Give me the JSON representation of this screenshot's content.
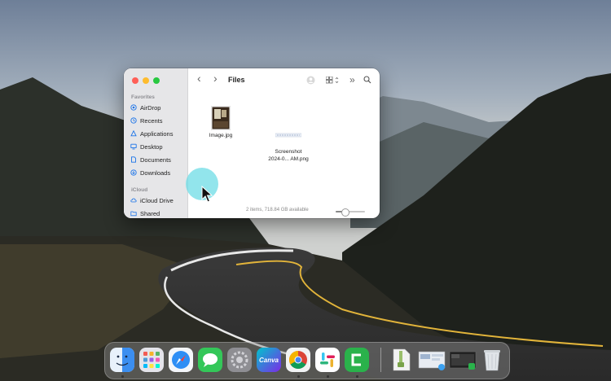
{
  "window": {
    "title": "Files",
    "nav": {
      "back": "‹",
      "forward": "›",
      "more": "»"
    },
    "sidebar": {
      "favorites_label": "Favorites",
      "favorites": [
        {
          "label": "AirDrop",
          "icon": "airdrop-icon"
        },
        {
          "label": "Recents",
          "icon": "clock-icon"
        },
        {
          "label": "Applications",
          "icon": "applications-icon"
        },
        {
          "label": "Desktop",
          "icon": "desktop-icon"
        },
        {
          "label": "Documents",
          "icon": "document-icon"
        },
        {
          "label": "Downloads",
          "icon": "download-icon"
        }
      ],
      "icloud_label": "iCloud",
      "icloud": [
        {
          "label": "iCloud Drive",
          "icon": "cloud-icon"
        },
        {
          "label": "Shared",
          "icon": "shared-folder-icon"
        }
      ]
    },
    "files": [
      {
        "name": "Image.jpg"
      },
      {
        "name_line1": "Screenshot",
        "name_line2": "2024-0... AM.png"
      }
    ],
    "status": "2 items, 718.84 GB available",
    "zoom_level": 0.3
  },
  "dock": {
    "apps": [
      "finder-icon",
      "launchpad-icon",
      "safari-icon",
      "messages-icon",
      "system-settings-icon",
      "canva-icon",
      "chrome-icon",
      "slack-icon",
      "camtasia-icon",
      "archive-icon",
      "screen-thumbnail-icon",
      "screen-thumbnail-icon",
      "trash-icon"
    ],
    "canva_label": "Canva"
  },
  "colors": {
    "accent": "#1a73e8",
    "close": "#ff5f57",
    "minimize": "#febc2e",
    "zoom": "#28c840"
  }
}
